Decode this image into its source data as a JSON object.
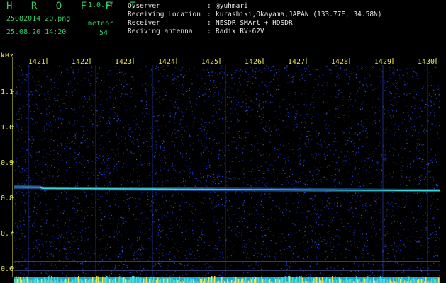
{
  "header": {
    "brand": "H R O F F T",
    "version": "1.0.0f",
    "filename": "25082014 20.png",
    "datetime": "25.08.20 14:20",
    "detect_type": "meteor",
    "detect_count": "54",
    "info": [
      {
        "label": "Ovserver",
        "sep": ":",
        "value": "@yuhmari"
      },
      {
        "label": "Receiving Location",
        "sep": ":",
        "value": "kurashiki,Okayama,JAPAN (133.77E, 34.58N)"
      },
      {
        "label": "Receiver",
        "sep": ":",
        "value": "NESDR SMArt + HDSDR"
      },
      {
        "label": "Reciving antenna",
        "sep": ":",
        "value": "Radix RV-62V"
      }
    ]
  },
  "axes": {
    "y_unit": "kHz",
    "x_ticks": [
      "1421",
      "1422",
      "1423",
      "1424",
      "1425",
      "1426",
      "1427",
      "1428",
      "1429",
      "1430"
    ],
    "y_ticks": [
      "1.1",
      "1.0",
      "0.9",
      "0.8",
      "0.7",
      "0.6"
    ],
    "y_tick_values": [
      1.1,
      1.0,
      0.9,
      0.8,
      0.7,
      0.6
    ]
  },
  "colors": {
    "background": "#000000",
    "noise": "#1c2fa8",
    "signal": "#3fd6d6",
    "text_green": "#33cc66",
    "text_yellow": "#e8e84a",
    "text_white": "#e6e6e6"
  }
}
